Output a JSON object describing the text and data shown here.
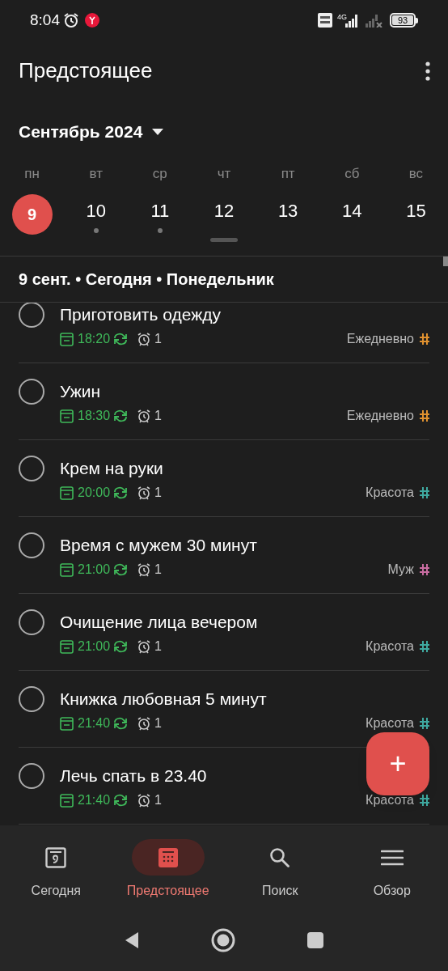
{
  "status_bar": {
    "time": "8:04",
    "battery": "93",
    "network": "4G"
  },
  "header": {
    "title": "Предстоящее",
    "month": "Сентябрь 2024"
  },
  "week": [
    {
      "weekday": "пн",
      "date": "9",
      "selected": true,
      "has_tasks": false
    },
    {
      "weekday": "вт",
      "date": "10",
      "selected": false,
      "has_tasks": true
    },
    {
      "weekday": "ср",
      "date": "11",
      "selected": false,
      "has_tasks": true
    },
    {
      "weekday": "чт",
      "date": "12",
      "selected": false,
      "has_tasks": false
    },
    {
      "weekday": "пт",
      "date": "13",
      "selected": false,
      "has_tasks": false
    },
    {
      "weekday": "сб",
      "date": "14",
      "selected": false,
      "has_tasks": false
    },
    {
      "weekday": "вс",
      "date": "15",
      "selected": false,
      "has_tasks": false
    }
  ],
  "section_title": "9 сент. • Сегодня • Понедельник",
  "tasks": [
    {
      "title": "Приготовить одежду",
      "time": "18:20",
      "reminders": "1",
      "project": "Ежедневно",
      "color": "#e0912f",
      "checked": false
    },
    {
      "title": "Ужин",
      "time": "18:30",
      "reminders": "1",
      "project": "Ежедневно",
      "color": "#e0912f",
      "checked": false
    },
    {
      "title": "Крем на руки",
      "time": "20:00",
      "reminders": "1",
      "project": "Красота",
      "color": "#3fa9a0",
      "checked": false
    },
    {
      "title": "Время с мужем 30 минут",
      "time": "21:00",
      "reminders": "1",
      "project": "Муж",
      "color": "#c86ca0",
      "checked": false
    },
    {
      "title": "Очищение лица вечером",
      "time": "21:00",
      "reminders": "1",
      "project": "Красота",
      "color": "#3fa9a0",
      "checked": false
    },
    {
      "title": "Книжка любовная 5 минут",
      "time": "21:40",
      "reminders": "1",
      "project": "Красота",
      "color": "#3fa9a0",
      "checked": false
    },
    {
      "title": "Лечь спать в 23.40",
      "time": "21:40",
      "reminders": "1",
      "project": "Красота",
      "color": "#3fa9a0",
      "checked": false
    }
  ],
  "fab": {
    "label": "+"
  },
  "nav": [
    {
      "label": "Сегодня",
      "kind": "today",
      "selected": false
    },
    {
      "label": "Предстоящее",
      "kind": "upcoming",
      "selected": true
    },
    {
      "label": "Поиск",
      "kind": "search",
      "selected": false
    },
    {
      "label": "Обзор",
      "kind": "browse",
      "selected": false
    }
  ]
}
